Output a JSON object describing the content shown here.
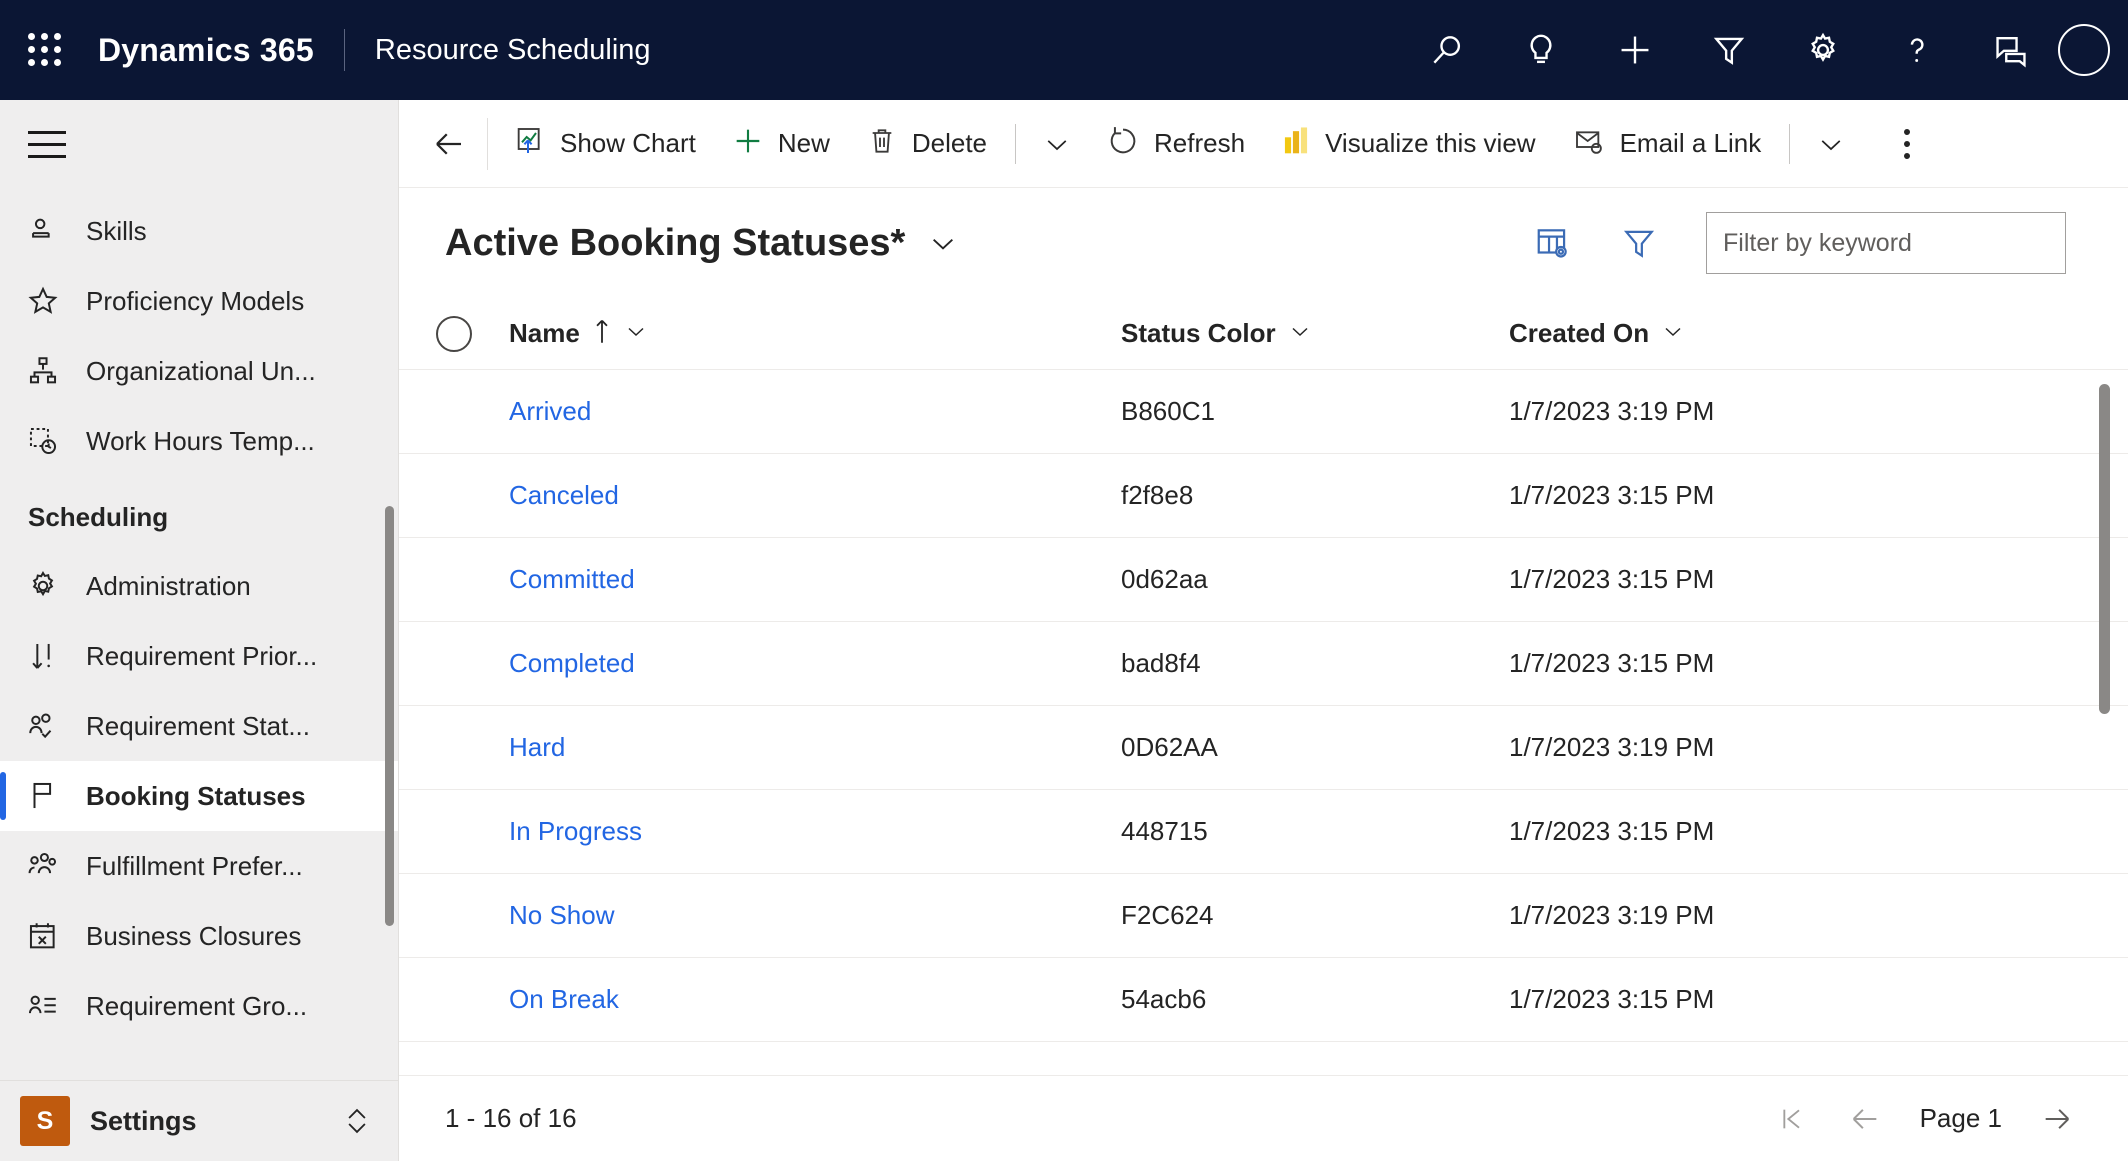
{
  "header": {
    "brand": "Dynamics 365",
    "app_name": "Resource Scheduling",
    "icons": [
      "search-icon",
      "lightbulb-icon",
      "plus-icon",
      "filter-icon",
      "gear-icon",
      "help-icon",
      "feedback-icon",
      "avatar"
    ]
  },
  "sidebar": {
    "items": [
      {
        "label": "Skills",
        "icon": "person-skill-icon",
        "selected": false
      },
      {
        "label": "Proficiency Models",
        "icon": "star-icon",
        "selected": false
      },
      {
        "label": "Organizational Un...",
        "icon": "org-chart-icon",
        "selected": false
      },
      {
        "label": "Work Hours Temp...",
        "icon": "work-hours-clock-icon",
        "selected": false
      }
    ],
    "group_title": "Scheduling",
    "group_items": [
      {
        "label": "Administration",
        "icon": "gear-icon",
        "selected": false
      },
      {
        "label": "Requirement Prior...",
        "icon": "sort-priority-icon",
        "selected": false
      },
      {
        "label": "Requirement Stat...",
        "icon": "people-check-icon",
        "selected": false
      },
      {
        "label": "Booking Statuses",
        "icon": "flag-icon",
        "selected": true
      },
      {
        "label": "Fulfillment Prefer...",
        "icon": "people-group-icon",
        "selected": false
      },
      {
        "label": "Business Closures",
        "icon": "calendar-x-icon",
        "selected": false
      },
      {
        "label": "Requirement Gro...",
        "icon": "person-list-icon",
        "selected": false
      }
    ],
    "area_switcher": {
      "badge": "S",
      "label": "Settings"
    }
  },
  "command_bar": {
    "back": "back-arrow-icon",
    "items": [
      {
        "label": "Show Chart",
        "icon": "show-chart-icon"
      },
      {
        "label": "New",
        "icon": "plus-icon"
      },
      {
        "label": "Delete",
        "icon": "trash-icon"
      }
    ],
    "visualize_label": "Visualize this view",
    "email_label": "Email a Link",
    "more_commands": "more-commands-icon"
  },
  "view": {
    "title": "Active Booking Statuses*",
    "edit_columns_icon": "edit-columns-icon",
    "edit_filters_icon": "edit-filters-icon",
    "search_placeholder": "Filter by keyword",
    "search_value": ""
  },
  "grid": {
    "columns": [
      {
        "label": "Name",
        "sort": "ascending"
      },
      {
        "label": "Status Color",
        "sort": ""
      },
      {
        "label": "Created On",
        "sort": ""
      }
    ],
    "rows": [
      {
        "name": "Arrived",
        "status_color": "B860C1",
        "created_on": "1/7/2023 3:19 PM"
      },
      {
        "name": "Canceled",
        "status_color": "f2f8e8",
        "created_on": "1/7/2023 3:15 PM"
      },
      {
        "name": "Committed",
        "status_color": "0d62aa",
        "created_on": "1/7/2023 3:15 PM"
      },
      {
        "name": "Completed",
        "status_color": "bad8f4",
        "created_on": "1/7/2023 3:15 PM"
      },
      {
        "name": "Hard",
        "status_color": "0D62AA",
        "created_on": "1/7/2023 3:19 PM"
      },
      {
        "name": "In Progress",
        "status_color": "448715",
        "created_on": "1/7/2023 3:15 PM"
      },
      {
        "name": "No Show",
        "status_color": "F2C624",
        "created_on": "1/7/2023 3:19 PM"
      },
      {
        "name": "On Break",
        "status_color": "54acb6",
        "created_on": "1/7/2023 3:15 PM"
      }
    ]
  },
  "footer": {
    "record_count": "1 - 16 of 16",
    "page_label": "Page 1"
  },
  "colors": {
    "header_bg": "#0b1634",
    "link": "#2266e3",
    "accent_orange": "#bf5a0e",
    "sidebar_bg": "#efeeee"
  }
}
